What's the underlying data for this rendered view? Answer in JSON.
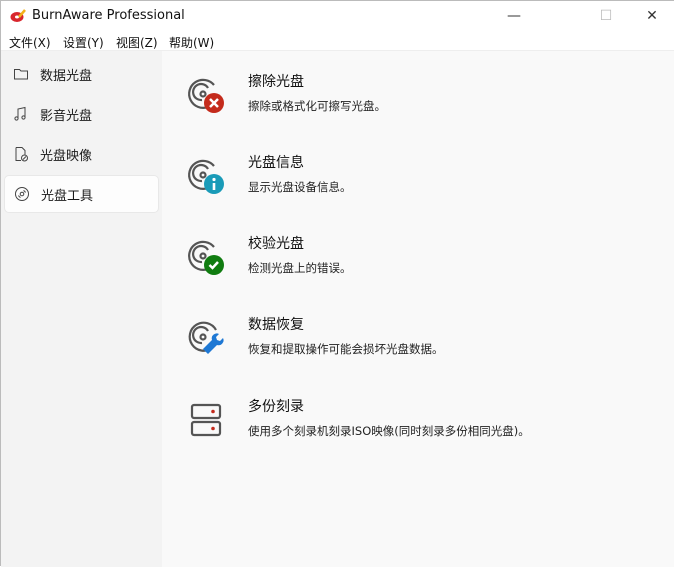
{
  "window": {
    "title": "BurnAware Professional"
  },
  "menu": [
    "文件(X)",
    "设置(Y)",
    "视图(Z)",
    "帮助(W)"
  ],
  "sidebar": {
    "items": [
      {
        "label": "数据光盘",
        "icon": "folder-icon"
      },
      {
        "label": "影音光盘",
        "icon": "music-icon"
      },
      {
        "label": "光盘映像",
        "icon": "disc-image-icon"
      },
      {
        "label": "光盘工具",
        "icon": "disc-icon",
        "selected": true
      }
    ]
  },
  "tools": [
    {
      "title": "擦除光盘",
      "desc": "擦除或格式化可擦写光盘。",
      "badge": "#c42b1c"
    },
    {
      "title": "光盘信息",
      "desc": "显示光盘设备信息。",
      "badge": "#1a9bb8"
    },
    {
      "title": "校验光盘",
      "desc": "检测光盘上的错误。",
      "badge": "#107c10"
    },
    {
      "title": "数据恢复",
      "desc": "恢复和提取操作可能会损坏光盘数据。",
      "badge": "#1e78d4"
    },
    {
      "title": "多份刻录",
      "desc": "使用多个刻录机刻录ISO映像(同时刻录多份相同光盘)。",
      "badge": "#c42b1c"
    }
  ]
}
